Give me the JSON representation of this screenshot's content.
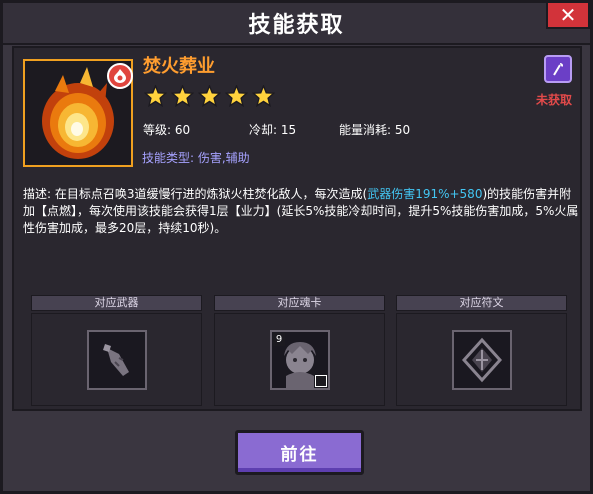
{
  "dialog": {
    "title": "技能获取",
    "close_icon": "close-x"
  },
  "skill": {
    "name": "焚火葬业",
    "stars": 5,
    "level_text": "等级: 60",
    "cooldown_text": "冷却: 15",
    "energy_text": "能量消耗: 50",
    "type_text": "技能类型: 伤害,辅助",
    "status": "未获取",
    "icon": "fire-skill-icon",
    "badge_icon": "fire-element-icon",
    "tag_icon": "staff-weapon-icon"
  },
  "description": {
    "part1": "描述: 在目标点召唤3道缓慢行进的炼狱火柱焚化敌人，每次造成(",
    "highlight": "武器伤害191%+580",
    "part2": ")的技能伤害并附加【点燃】，每次使用该技能会获得1层【业力】(延长5%技能冷却时间，提升5%技能伤害加成，5%火属性伤害加成，最多20层，持续10秒)。"
  },
  "slots": [
    {
      "label": "对应武器",
      "icon": "weapon-icon"
    },
    {
      "label": "对应魂卡",
      "icon": "soul-card-icon",
      "badge": "9"
    },
    {
      "label": "对应符文",
      "icon": "rune-icon"
    }
  ],
  "actions": {
    "go_label": "前往"
  },
  "colors": {
    "skill_name": "#ff9d2f",
    "status": "#e34a4a",
    "highlight": "#43c5f2",
    "skill_type": "#a6a2ff",
    "button": "#8a6bd2"
  }
}
